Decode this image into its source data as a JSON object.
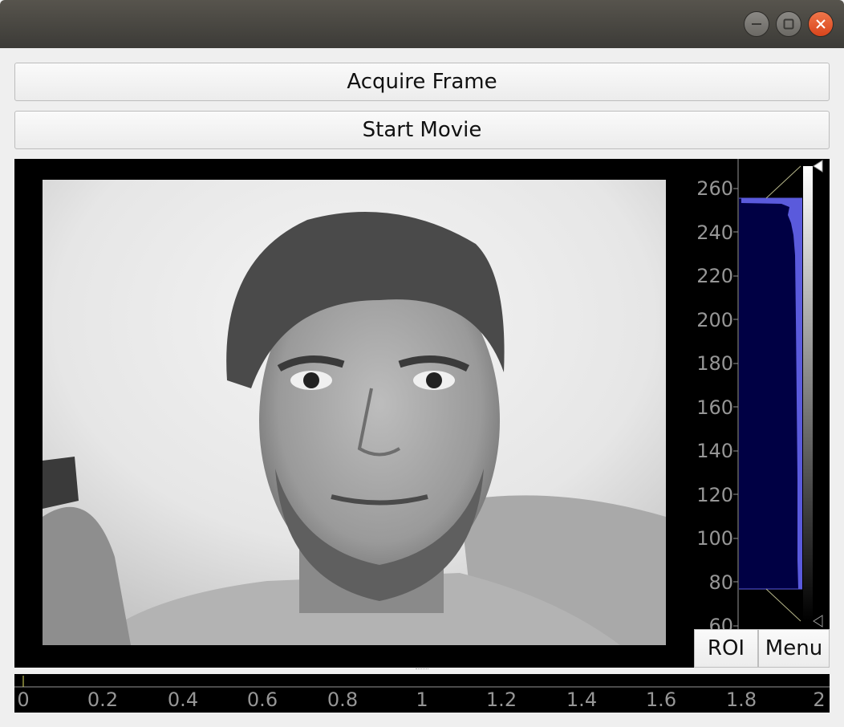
{
  "window": {
    "controls": [
      "minimize-icon",
      "maximize-icon",
      "close-icon"
    ],
    "colors": {
      "titlebar": "#3c3b37",
      "close": "#e05a2c"
    }
  },
  "buttons": {
    "acquire_label": "Acquire Frame",
    "movie_label": "Start Movie",
    "roi_label": "ROI",
    "menu_label": "Menu"
  },
  "histogram": {
    "axis_ticks": [
      "260",
      "240",
      "220",
      "200",
      "180",
      "160",
      "140",
      "120",
      "100",
      "80",
      "60"
    ],
    "level_min": 76,
    "level_max": 255,
    "fill_color": "#5a5adc",
    "region_color": "#000044"
  },
  "timeline": {
    "ticks": [
      "0",
      "0.2",
      "0.4",
      "0.6",
      "0.8",
      "1",
      "1.2",
      "1.4",
      "1.6",
      "1.8",
      "2"
    ]
  }
}
